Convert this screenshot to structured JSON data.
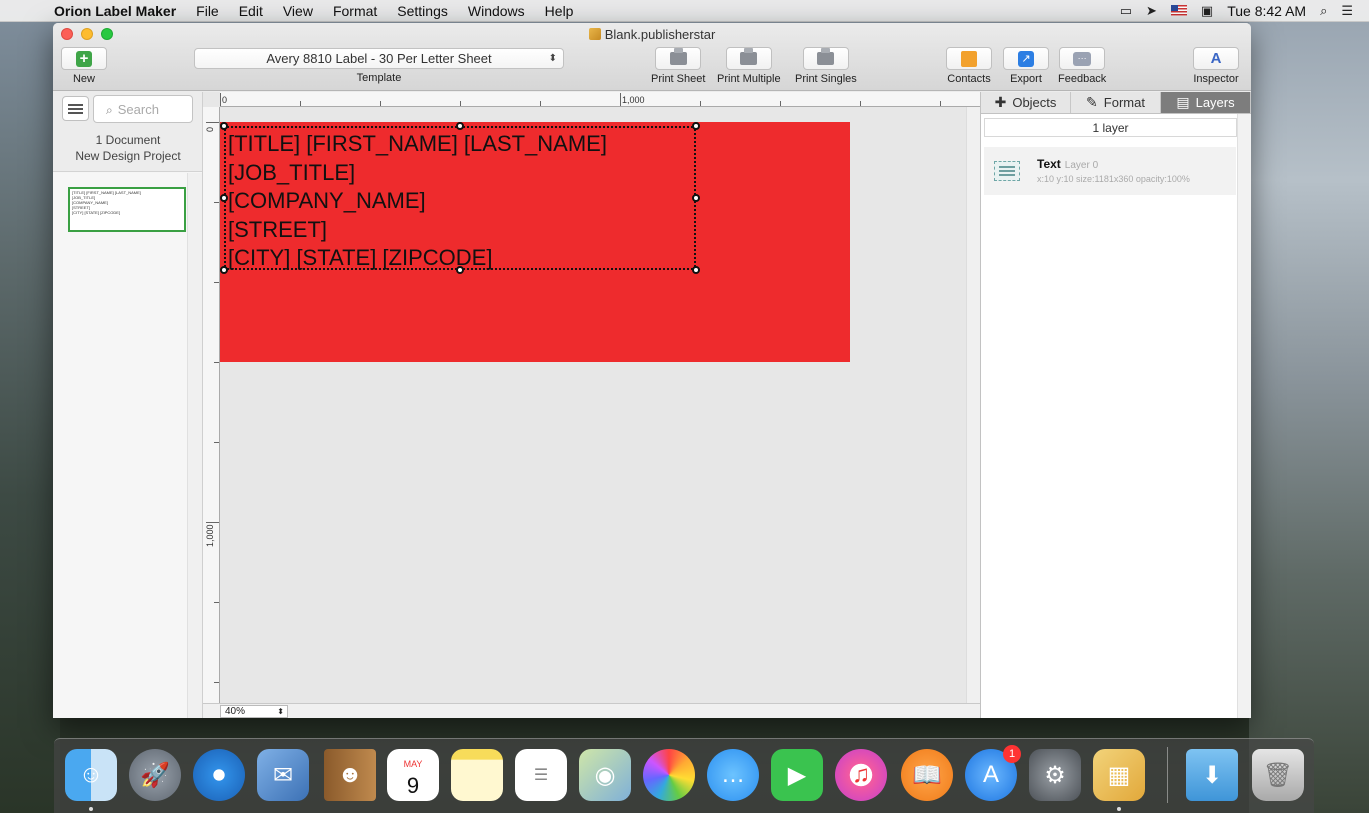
{
  "menubar": {
    "app_name": "Orion Label Maker",
    "items": [
      "File",
      "Edit",
      "View",
      "Format",
      "Settings",
      "Windows",
      "Help"
    ],
    "clock": "Tue 8:42 AM"
  },
  "window": {
    "title": "Blank.publisherstar"
  },
  "toolbar": {
    "new_label": "New",
    "template_value": "Avery 8810 Label - 30 Per Letter Sheet",
    "template_label": "Template",
    "print_sheet_label": "Print Sheet",
    "print_multiple_label": "Print Multiple",
    "print_singles_label": "Print Singles",
    "contacts_label": "Contacts",
    "export_label": "Export",
    "feedback_label": "Feedback",
    "inspector_label": "Inspector",
    "inspector_glyph": "A"
  },
  "sidebar": {
    "search_placeholder": "Search",
    "doc_count": "1 Document",
    "project_name": "New Design Project"
  },
  "canvas": {
    "ruler_marks": {
      "zero": "0",
      "thousand": "1,000"
    },
    "label_color": "#ee2b2d",
    "text_lines": [
      "[TITLE] [FIRST_NAME] [LAST_NAME]",
      "[JOB_TITLE]",
      "[COMPANY_NAME]",
      "[STREET]",
      "[CITY] [STATE] [ZIPCODE]"
    ],
    "zoom": "40%"
  },
  "inspector": {
    "tabs": [
      {
        "label": "Objects",
        "icon": "plus-icon"
      },
      {
        "label": "Format",
        "icon": "edit-icon"
      },
      {
        "label": "Layers",
        "icon": "layers-icon",
        "active": true
      }
    ],
    "layer_count": "1 layer",
    "layer": {
      "name": "Text",
      "sub": "Layer 0",
      "meta": "x:10 y:10 size:1181x360 opacity:100%"
    }
  },
  "dock": {
    "calendar_month": "MAY",
    "calendar_day": "9",
    "app_store_badge": "1"
  }
}
